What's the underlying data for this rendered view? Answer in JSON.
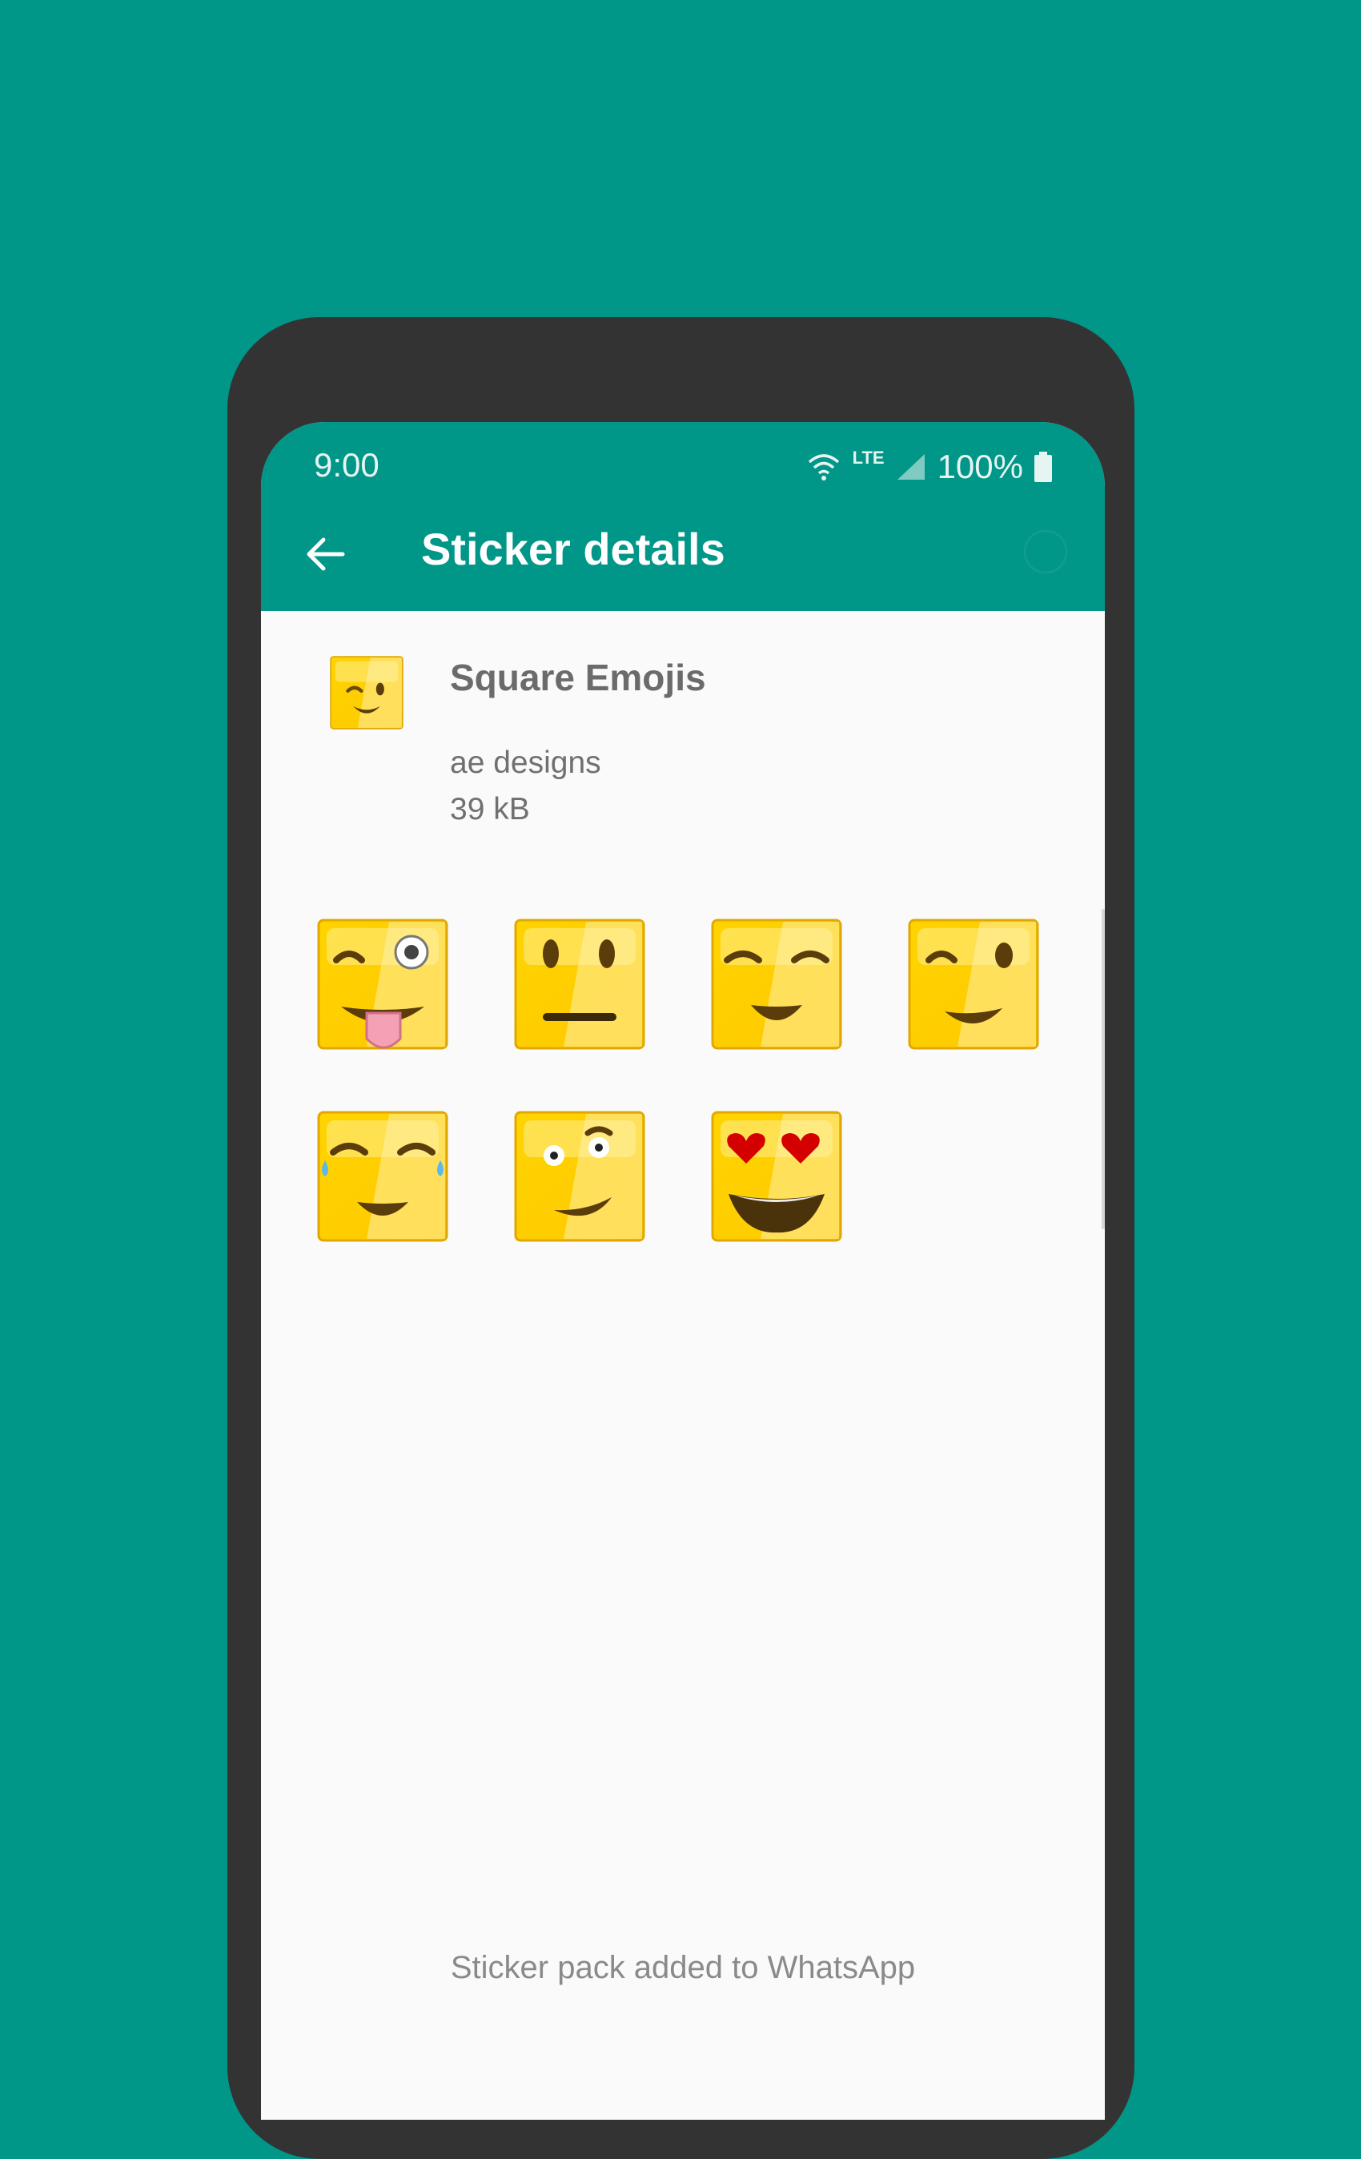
{
  "status_bar": {
    "time": "9:00",
    "network_type": "LTE",
    "battery": "100%",
    "icons": [
      "wifi-icon",
      "cell-signal-icon",
      "battery-icon"
    ]
  },
  "app_bar": {
    "title": "Sticker details",
    "back_icon": "arrow-back-icon",
    "info_icon": "info-icon"
  },
  "pack": {
    "name": "Square Emojis",
    "publisher": "ae designs",
    "size": "39 kB",
    "tray_icon": "wink-emoji"
  },
  "stickers": [
    {
      "name": "tongue-wink"
    },
    {
      "name": "neutral"
    },
    {
      "name": "smiling-closed-eyes"
    },
    {
      "name": "wink-smile"
    },
    {
      "name": "tears-of-joy"
    },
    {
      "name": "raised-eyebrow"
    },
    {
      "name": "heart-eyes"
    }
  ],
  "footer": {
    "status_text": "Sticker pack added to WhatsApp"
  },
  "colors": {
    "primary": "#009688",
    "phone_frame": "#333333",
    "screen_bg": "#fafafa",
    "sticker_yellow": "#ffd21a"
  }
}
